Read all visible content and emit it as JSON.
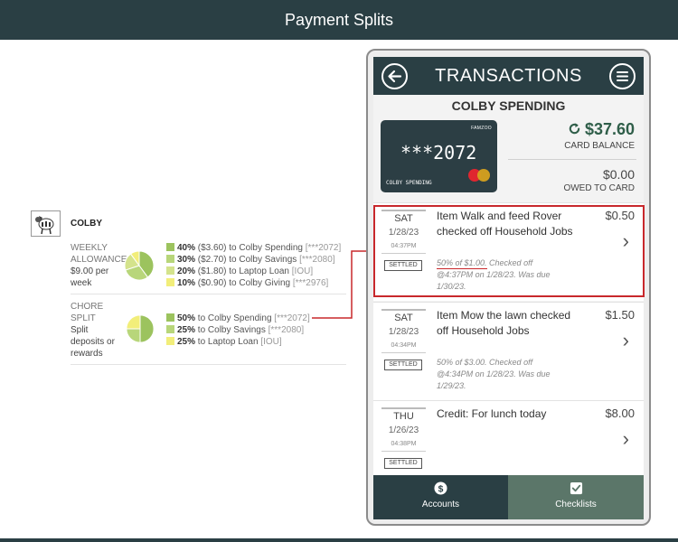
{
  "header": {
    "title": "Payment Splits"
  },
  "kid": {
    "name": "COLBY"
  },
  "splits": [
    {
      "title_lines": [
        "WEEKLY",
        "ALLOWANCE"
      ],
      "sub_lines": [
        "$9.00  per",
        "week"
      ],
      "pie_values": [
        40,
        30,
        20,
        10
      ],
      "lines": [
        {
          "pct": "40%",
          "amount": "($3.60)",
          "to": "to Colby Spending",
          "acct": "[***2072]",
          "color": "#9cc35e"
        },
        {
          "pct": "30%",
          "amount": "($2.70)",
          "to": "to Colby Savings",
          "acct": "[***2080]",
          "color": "#b8d67a"
        },
        {
          "pct": "20%",
          "amount": "($1.80)",
          "to": "to Laptop Loan",
          "acct": "[IOU]",
          "color": "#d4e38c"
        },
        {
          "pct": "10%",
          "amount": "($0.90)",
          "to": "to Colby Giving",
          "acct": "[***2976]",
          "color": "#f2ee7a"
        }
      ]
    },
    {
      "title_lines": [
        "CHORE",
        "SPLIT"
      ],
      "sub_lines": [
        "Split",
        "deposits or",
        "rewards"
      ],
      "pie_values": [
        50,
        25,
        25
      ],
      "lines": [
        {
          "pct": "50%",
          "amount": "",
          "to": "to Colby Spending",
          "acct": "[***2072]",
          "color": "#9cc35e"
        },
        {
          "pct": "25%",
          "amount": "",
          "to": "to Colby Savings",
          "acct": "[***2080]",
          "color": "#b8d67a"
        },
        {
          "pct": "25%",
          "amount": "",
          "to": "to Laptop Loan",
          "acct": "[IOU]",
          "color": "#f2ee7a"
        }
      ]
    }
  ],
  "phone": {
    "title": "TRANSACTIONS",
    "back_icon": "arrow-left-icon",
    "menu_icon": "menu-icon",
    "account_name": "COLBY SPENDING",
    "card": {
      "brand": "FAMZOO",
      "number": "***2072",
      "holder": "COLBY SPENDING"
    },
    "balance": {
      "amount": "$37.60",
      "label": "CARD BALANCE"
    },
    "owed": {
      "amount": "$0.00",
      "label": "OWED TO CARD"
    },
    "transactions": [
      {
        "dow": "SAT",
        "date": "1/28/23",
        "time": "04:37PM",
        "status": "SETTLED",
        "title": "Item Walk and feed Rover checked off Household Jobs",
        "note": "50% of $1.00. Checked off @4:37PM on 1/28/23. Was due 1/30/23.",
        "amount": "$0.50",
        "highlighted": true
      },
      {
        "dow": "SAT",
        "date": "1/28/23",
        "time": "04:34PM",
        "status": "SETTLED",
        "title": "Item Mow the lawn checked off Household Jobs",
        "note": "50% of $3.00. Checked off @4:34PM on 1/28/23. Was due 1/29/23.",
        "amount": "$1.50",
        "highlighted": false
      },
      {
        "dow": "THU",
        "date": "1/26/23",
        "time": "04:38PM",
        "status": "SETTLED",
        "title": "Credit: For lunch today",
        "note": "",
        "amount": "$8.00",
        "highlighted": false
      }
    ],
    "tabs": [
      {
        "label": "Accounts",
        "icon": "dollar-coin-icon",
        "active": true
      },
      {
        "label": "Checklists",
        "icon": "checkbox-icon",
        "active": false
      }
    ]
  },
  "colors": {
    "header": "#2a3f44",
    "money_green": "#2f5e49",
    "highlight": "#c8282c",
    "tab_inactive": "#5b7669"
  }
}
